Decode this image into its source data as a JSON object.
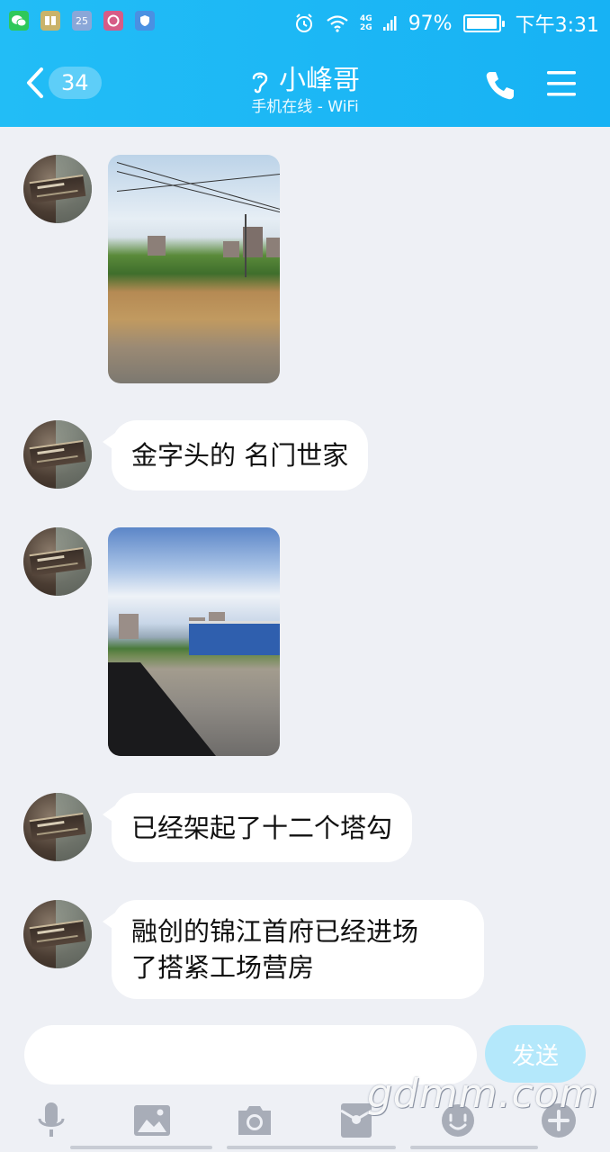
{
  "status_bar": {
    "apps": [
      {
        "icon": "wechat-icon",
        "color": "#2fc85a",
        "text": ""
      },
      {
        "icon": "book-app-icon",
        "color": "#c9b36a",
        "text": ""
      },
      {
        "icon": "calendar-icon",
        "color": "#8aa7d8",
        "text": "25"
      },
      {
        "icon": "record-app-icon",
        "color": "#d65c86",
        "text": ""
      },
      {
        "icon": "shield-app-icon",
        "color": "#4a90e2",
        "text": ""
      }
    ],
    "network_top": "4G",
    "network_bottom": "2G",
    "battery_percent": "97%",
    "battery_level": 0.97,
    "time": "下午3:31"
  },
  "header": {
    "unread_count": "34",
    "contact_name": "小峰哥",
    "status": "手机在线 - WiFi",
    "accent_color": "#1db8f5"
  },
  "messages": [
    {
      "type": "image",
      "description_icon": "photo-construction-site"
    },
    {
      "type": "text",
      "text": "金字头的 名门世家"
    },
    {
      "type": "image",
      "description_icon": "photo-construction-site"
    },
    {
      "type": "text",
      "text": "已经架起了十二个塔勾"
    },
    {
      "type": "text",
      "text": "融创的锦江首府已经进场\n了搭紧工场营房"
    }
  ],
  "input": {
    "value": "",
    "send_label": "发送"
  },
  "toolbar": {
    "items": [
      "microphone-icon",
      "image-icon",
      "camera-icon",
      "red-packet-icon",
      "emoji-icon",
      "plus-icon"
    ]
  },
  "watermark": "gdmm.com"
}
